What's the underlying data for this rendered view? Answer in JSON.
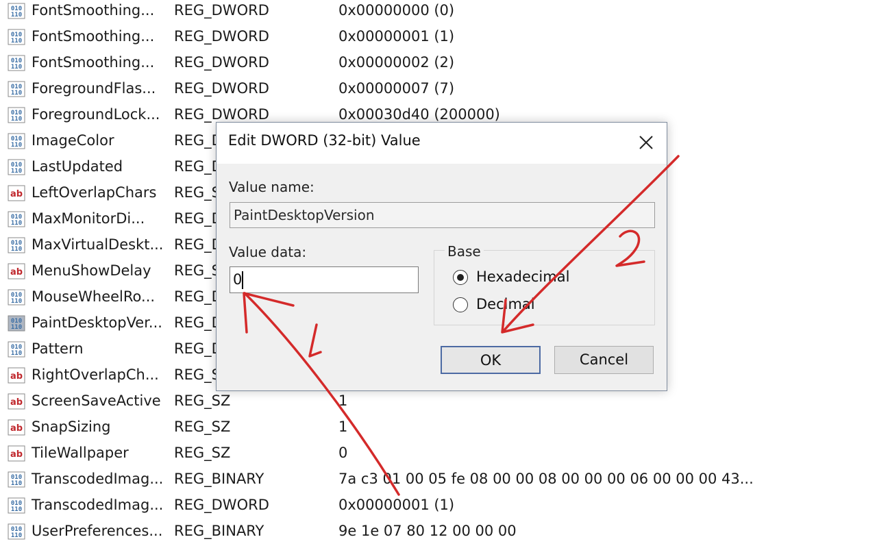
{
  "registry": {
    "rows": [
      {
        "name": "FontSmoothing...",
        "type": "REG_DWORD",
        "data": "0x00000000 (0)",
        "icon": "binary-value-icon"
      },
      {
        "name": "FontSmoothing...",
        "type": "REG_DWORD",
        "data": "0x00000001 (1)",
        "icon": "binary-value-icon"
      },
      {
        "name": "FontSmoothing...",
        "type": "REG_DWORD",
        "data": "0x00000002 (2)",
        "icon": "binary-value-icon"
      },
      {
        "name": "ForegroundFlas...",
        "type": "REG_DWORD",
        "data": "0x00000007 (7)",
        "icon": "binary-value-icon"
      },
      {
        "name": "ForegroundLock...",
        "type": "REG_DWORD",
        "data": "0x00030d40 (200000)",
        "icon": "binary-value-icon"
      },
      {
        "name": "ImageColor",
        "type": "REG_D",
        "data": "",
        "icon": "binary-value-icon"
      },
      {
        "name": "LastUpdated",
        "type": "REG_D",
        "data": "",
        "icon": "binary-value-icon"
      },
      {
        "name": "LeftOverlapChars",
        "type": "REG_S",
        "data": "",
        "icon": "string-value-icon"
      },
      {
        "name": "MaxMonitorDi...",
        "type": "REG_D",
        "data": "",
        "icon": "binary-value-icon"
      },
      {
        "name": "MaxVirtualDeskt...",
        "type": "REG_D",
        "data": "",
        "icon": "binary-value-icon"
      },
      {
        "name": "MenuShowDelay",
        "type": "REG_S",
        "data": "",
        "icon": "string-value-icon"
      },
      {
        "name": "MouseWheelRo...",
        "type": "REG_D",
        "data": "",
        "icon": "binary-value-icon"
      },
      {
        "name": "PaintDesktopVer...",
        "type": "REG_D",
        "data": "",
        "icon": "binary-value-icon",
        "selected": true
      },
      {
        "name": "Pattern",
        "type": "REG_D",
        "data": "",
        "icon": "binary-value-icon"
      },
      {
        "name": "RightOverlapCh...",
        "type": "REG_S",
        "data": "",
        "icon": "string-value-icon"
      },
      {
        "name": "ScreenSaveActive",
        "type": "REG_SZ",
        "data": "1",
        "icon": "string-value-icon"
      },
      {
        "name": "SnapSizing",
        "type": "REG_SZ",
        "data": "1",
        "icon": "string-value-icon"
      },
      {
        "name": "TileWallpaper",
        "type": "REG_SZ",
        "data": "0",
        "icon": "string-value-icon"
      },
      {
        "name": "TranscodedImag...",
        "type": "REG_BINARY",
        "data": "7a c3 01 00 05 fe 08 00 00 08 00 00 00 06 00 00 00 43...",
        "icon": "binary-value-icon"
      },
      {
        "name": "TranscodedImag...",
        "type": "REG_DWORD",
        "data": "0x00000001 (1)",
        "icon": "binary-value-icon"
      },
      {
        "name": "UserPreferences...",
        "type": "REG_BINARY",
        "data": "9e 1e 07 80 12 00 00 00",
        "icon": "binary-value-icon"
      }
    ]
  },
  "dialog": {
    "title": "Edit DWORD (32-bit) Value",
    "value_name_label": "Value name:",
    "value_name": "PaintDesktopVersion",
    "value_data_label": "Value data:",
    "value_data": "0",
    "base_label": "Base",
    "options": [
      {
        "label": "Hexadecimal",
        "checked": true
      },
      {
        "label": "Decimal",
        "checked": false
      }
    ],
    "ok_label": "OK",
    "cancel_label": "Cancel"
  },
  "annotations": {
    "color": "#d42a2a",
    "labels": [
      "1",
      "2"
    ]
  },
  "colors": {
    "binary_icon": "#3a6ea5",
    "string_icon": "#c0282d",
    "ok_border": "#4c6aa3"
  }
}
